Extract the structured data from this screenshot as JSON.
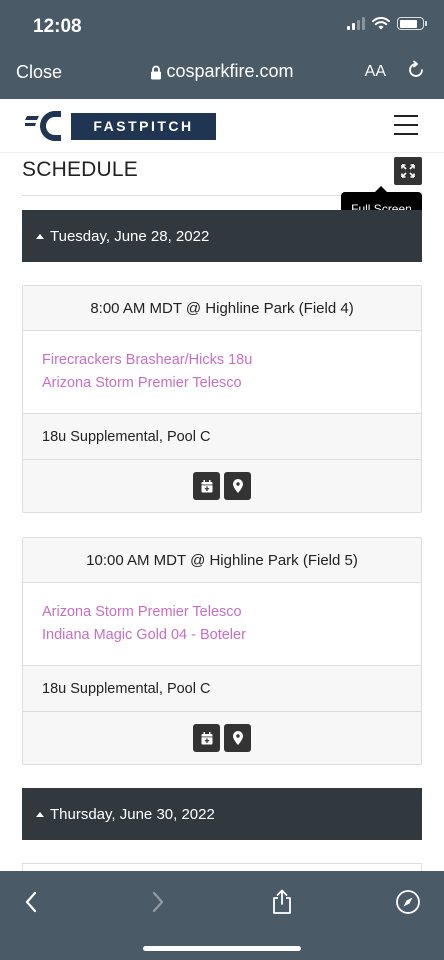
{
  "status": {
    "time": "12:08"
  },
  "browser": {
    "close_label": "Close",
    "url": "cosparkfire.com",
    "text_size_label": "AA"
  },
  "site": {
    "brand_text": "FASTPITCH"
  },
  "schedule": {
    "title": "SCHEDULE",
    "fullscreen_tooltip": "Full Screen",
    "days": [
      {
        "date": "Tuesday, June 28, 2022",
        "games": [
          {
            "time_location": "8:00 AM MDT @ Highline Park (Field 4)",
            "teams": [
              "Firecrackers Brashear/Hicks 18u",
              "Arizona Storm Premier Telesco"
            ],
            "pool": "18u Supplemental, Pool C"
          },
          {
            "time_location": "10:00 AM MDT @ Highline Park (Field 5)",
            "teams": [
              "Arizona Storm Premier Telesco",
              "Indiana Magic Gold 04 - Boteler"
            ],
            "pool": "18u Supplemental, Pool C"
          }
        ]
      },
      {
        "date": "Thursday, June 30, 2022",
        "games": []
      }
    ]
  },
  "colors": {
    "chrome": "#4a5a66",
    "day_header": "#31383e",
    "team_link": "#c86ec3",
    "brand_navy": "#1f3552"
  },
  "icons": {
    "fullscreen": "expand-arrows-icon",
    "calendar": "calendar-add-icon",
    "location": "map-pin-icon",
    "back": "chevron-left-icon",
    "forward": "chevron-right-icon",
    "share": "share-icon",
    "safari": "compass-icon"
  }
}
